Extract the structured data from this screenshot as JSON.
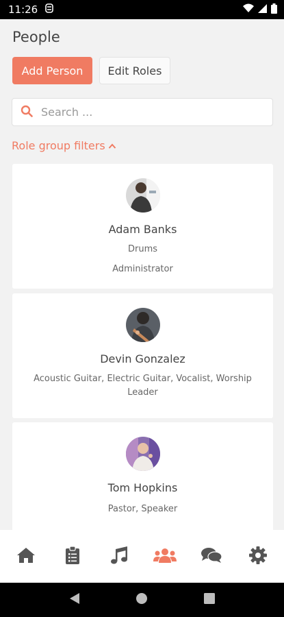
{
  "status_bar": {
    "time": "11:26"
  },
  "header": {
    "title": "People",
    "add_person_label": "Add Person",
    "edit_roles_label": "Edit Roles"
  },
  "search": {
    "placeholder": "Search ...",
    "value": ""
  },
  "filters": {
    "label": "Role group filters"
  },
  "people": [
    {
      "name": "Adam Banks",
      "roles": [
        "Drums",
        "Administrator"
      ]
    },
    {
      "name": "Devin Gonzalez",
      "roles": [
        "Acoustic Guitar, Electric Guitar, Vocalist, Worship Leader"
      ]
    },
    {
      "name": "Tom Hopkins",
      "roles": [
        "Pastor, Speaker"
      ]
    }
  ],
  "bottom_nav": {
    "active": "people",
    "items": [
      "home",
      "plans",
      "songs",
      "people",
      "messages",
      "settings"
    ]
  },
  "colors": {
    "accent": "#f07b62",
    "inactive_icon": "#555555"
  }
}
